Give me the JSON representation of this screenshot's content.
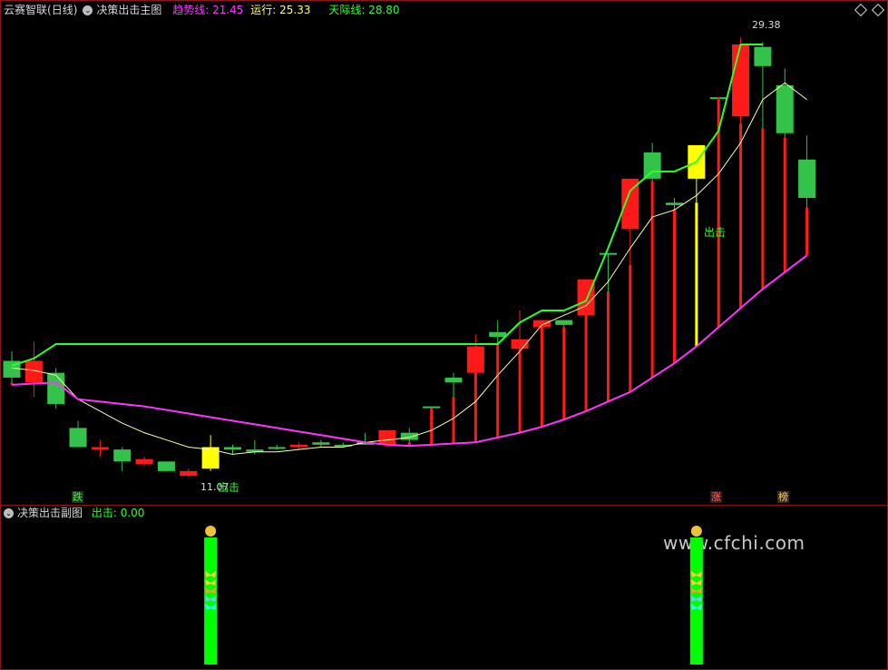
{
  "header": {
    "app_name": "云赛智联",
    "period": "(日线)",
    "main_title": "决策出击主图",
    "trend_label": "趋势线: 21.45",
    "run_label": "运行: 25.33",
    "sky_label": "天际线: 28.80"
  },
  "sub_header": {
    "title": "决策出击副图",
    "value_label": "出击: 0.00"
  },
  "annotations": {
    "high_price": "29.38",
    "low_price": "11.07",
    "strike_label_1": "出击",
    "strike_label_2": "出击",
    "tag_down": "跌",
    "tag_up": "涨",
    "tag_list": "榜"
  },
  "watermark": "www.cfchi.com",
  "colors": {
    "up": "#ff1a1a",
    "down": "#33c24a",
    "signal": "#ffff00",
    "trend": "#ff33ff",
    "sky": "#2aff2a",
    "run": "#ffffa0",
    "cyan": "#33ffff",
    "bar_green": "#00ff00"
  },
  "chart_data": {
    "type": "candlestick",
    "title": "决策出击主图",
    "ylim": [
      10.5,
      30.2
    ],
    "candles": [
      {
        "o": 15.9,
        "c": 15.2,
        "h": 16.3,
        "l": 15.0,
        "k": "down"
      },
      {
        "o": 15.0,
        "c": 15.9,
        "h": 16.7,
        "l": 14.4,
        "k": "up"
      },
      {
        "o": 15.4,
        "c": 14.1,
        "h": 15.6,
        "l": 13.9,
        "k": "down"
      },
      {
        "o": 13.1,
        "c": 12.3,
        "h": 13.4,
        "l": 12.3,
        "k": "down"
      },
      {
        "o": 12.2,
        "c": 12.3,
        "h": 12.6,
        "l": 11.9,
        "k": "up"
      },
      {
        "o": 12.2,
        "c": 11.7,
        "h": 12.3,
        "l": 11.3,
        "k": "down"
      },
      {
        "o": 11.6,
        "c": 11.8,
        "h": 11.9,
        "l": 11.5,
        "k": "up"
      },
      {
        "o": 11.7,
        "c": 11.3,
        "h": 11.7,
        "l": 11.3,
        "k": "down"
      },
      {
        "o": 11.1,
        "c": 11.3,
        "h": 11.4,
        "l": 11.07,
        "k": "up"
      },
      {
        "o": 11.4,
        "c": 12.3,
        "h": 12.8,
        "l": 11.3,
        "k": "signal"
      },
      {
        "o": 12.3,
        "c": 12.2,
        "h": 12.4,
        "l": 12.0,
        "k": "down"
      },
      {
        "o": 12.2,
        "c": 12.1,
        "h": 12.6,
        "l": 12.0,
        "k": "down"
      },
      {
        "o": 12.3,
        "c": 12.3,
        "h": 12.4,
        "l": 12.2,
        "k": "flat"
      },
      {
        "o": 12.3,
        "c": 12.4,
        "h": 12.5,
        "l": 12.2,
        "k": "up"
      },
      {
        "o": 12.5,
        "c": 12.4,
        "h": 12.6,
        "l": 12.3,
        "k": "down"
      },
      {
        "o": 12.4,
        "c": 12.4,
        "h": 12.5,
        "l": 12.3,
        "k": "flat"
      },
      {
        "o": 12.5,
        "c": 12.4,
        "h": 12.9,
        "l": 12.4,
        "k": "down"
      },
      {
        "o": 12.4,
        "c": 13.0,
        "h": 13.0,
        "l": 12.4,
        "k": "up"
      },
      {
        "o": 12.9,
        "c": 12.6,
        "h": 13.1,
        "l": 12.5,
        "k": "down"
      },
      {
        "o": 14.0,
        "c": 14.0,
        "h": 14.0,
        "l": 13.9,
        "k": "flat"
      },
      {
        "o": 15.2,
        "c": 15.0,
        "h": 15.4,
        "l": 14.4,
        "k": "down"
      },
      {
        "o": 15.4,
        "c": 16.5,
        "h": 17.0,
        "l": 15.4,
        "k": "up"
      },
      {
        "o": 17.1,
        "c": 16.9,
        "h": 17.6,
        "l": 16.6,
        "k": "down"
      },
      {
        "o": 16.4,
        "c": 16.8,
        "h": 18.0,
        "l": 16.4,
        "k": "up"
      },
      {
        "o": 17.3,
        "c": 17.6,
        "h": 17.6,
        "l": 17.3,
        "k": "up"
      },
      {
        "o": 17.6,
        "c": 17.4,
        "h": 17.6,
        "l": 17.3,
        "k": "down"
      },
      {
        "o": 17.8,
        "c": 19.3,
        "h": 19.3,
        "l": 17.8,
        "k": "up"
      },
      {
        "o": 20.4,
        "c": 20.4,
        "h": 20.4,
        "l": 18.8,
        "k": "flat"
      },
      {
        "o": 21.4,
        "c": 23.5,
        "h": 23.5,
        "l": 19.9,
        "k": "up"
      },
      {
        "o": 23.5,
        "c": 24.6,
        "h": 25.0,
        "l": 23.4,
        "k": "down"
      },
      {
        "o": 22.5,
        "c": 22.4,
        "h": 22.7,
        "l": 22.2,
        "k": "flat"
      },
      {
        "o": 23.5,
        "c": 24.9,
        "h": 24.9,
        "l": 22.5,
        "k": "signal"
      },
      {
        "o": 26.9,
        "c": 26.9,
        "h": 26.9,
        "l": 26.9,
        "k": "flat"
      },
      {
        "o": 26.1,
        "c": 29.1,
        "h": 29.38,
        "l": 25.8,
        "k": "up"
      },
      {
        "o": 28.2,
        "c": 29.0,
        "h": 29.2,
        "l": 25.6,
        "k": "down"
      },
      {
        "o": 27.4,
        "c": 25.4,
        "h": 28.1,
        "l": 25.2,
        "k": "down"
      },
      {
        "o": 24.3,
        "c": 22.7,
        "h": 25.3,
        "l": 22.3,
        "k": "down"
      }
    ],
    "trend_line": [
      14.9,
      14.95,
      15.0,
      14.3,
      14.2,
      14.1,
      14.0,
      13.85,
      13.7,
      13.55,
      13.4,
      13.25,
      13.1,
      12.95,
      12.8,
      12.65,
      12.5,
      12.4,
      12.35,
      12.4,
      12.45,
      12.5,
      12.7,
      12.9,
      13.15,
      13.45,
      13.8,
      14.2,
      14.6,
      15.2,
      15.8,
      16.5,
      17.3,
      18.1,
      18.9,
      19.6,
      20.3
    ],
    "sky_line": [
      15.7,
      16.0,
      16.6,
      16.6,
      16.6,
      16.6,
      16.6,
      16.6,
      16.6,
      16.6,
      16.6,
      16.6,
      16.6,
      16.6,
      16.6,
      16.6,
      16.6,
      16.6,
      16.6,
      16.6,
      16.6,
      16.6,
      16.6,
      17.5,
      18.0,
      18.0,
      18.4,
      20.6,
      23.0,
      23.8,
      23.8,
      24.2,
      25.5,
      29.1,
      29.1
    ],
    "run_line": [
      15.6,
      15.5,
      15.3,
      14.3,
      13.8,
      13.3,
      12.9,
      12.6,
      12.3,
      12.2,
      12.0,
      12.1,
      12.1,
      12.2,
      12.3,
      12.3,
      12.5,
      12.6,
      12.7,
      13.0,
      13.5,
      14.2,
      15.3,
      16.3,
      17.4,
      17.8,
      18.2,
      19.2,
      20.6,
      21.9,
      22.2,
      22.8,
      23.7,
      25.0,
      26.8,
      27.5,
      26.8
    ]
  },
  "sub_chart_data": {
    "type": "bar",
    "title": "决策出击副图",
    "signal_candle_index": [
      9,
      31
    ]
  }
}
